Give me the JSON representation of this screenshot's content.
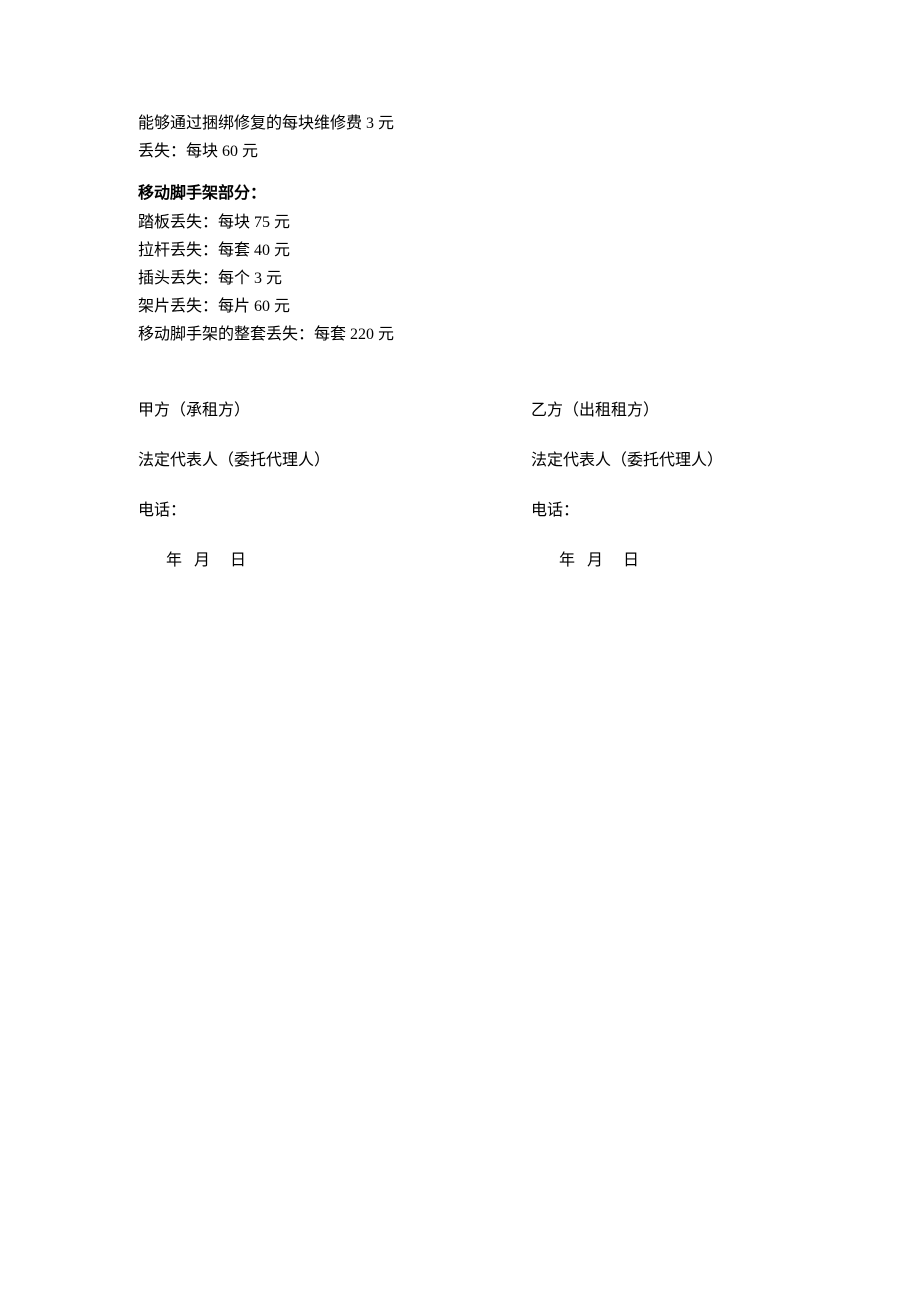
{
  "top": {
    "line1": "能够通过捆绑修复的每块维修费 3 元",
    "line2": "丢失：每块 60 元"
  },
  "section": {
    "heading": "移动脚手架部分：",
    "items": [
      "踏板丢失：每块 75 元",
      "拉杆丢失：每套 40 元",
      "插头丢失：每个 3 元",
      "架片丢失：每片 60 元",
      "移动脚手架的整套丢失：每套 220 元"
    ]
  },
  "signature": {
    "partyA": {
      "title": "甲方（承租方）",
      "rep": "法定代表人（委托代理人）",
      "phone": "电话：",
      "year": "年",
      "month": "月",
      "day": "日"
    },
    "partyB": {
      "title": "乙方（出租租方）",
      "rep": "法定代表人（委托代理人）",
      "phone": "电话：",
      "year": "年",
      "month": "月",
      "day": "日"
    }
  }
}
